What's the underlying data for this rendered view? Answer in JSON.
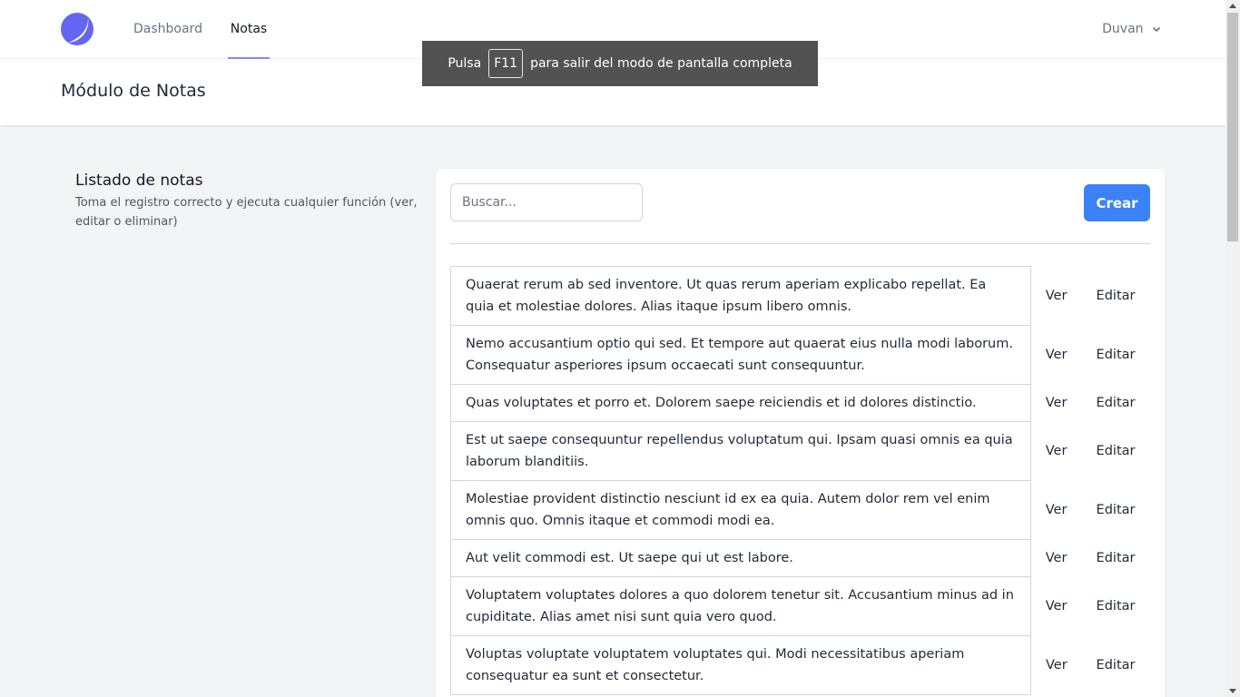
{
  "nav": {
    "logo_icon": "app-logo-icon",
    "links": [
      {
        "label": "Dashboard"
      },
      {
        "label": "Notas"
      }
    ],
    "user": "Duvan",
    "user_icon": "chevron-down-icon"
  },
  "header": {
    "title": "Módulo de Notas"
  },
  "toast": {
    "prefix": "Pulsa",
    "key": "F11",
    "suffix": "para salir del modo de pantalla completa"
  },
  "section": {
    "title": "Listado de notas",
    "description": "Toma el registro correcto y ejecuta cualquier función (ver, editar o eliminar)"
  },
  "toolbar": {
    "search_placeholder": "Buscar...",
    "create_label": "Crear"
  },
  "colors": {
    "primary": "#3b82f6",
    "active_tab_border": "#818cf8",
    "logo": "#6366f1"
  },
  "notes": [
    {
      "text": "Quaerat rerum ab sed inventore. Ut quas rerum aperiam explicabo repellat. Ea quia et molestiae dolores. Alias itaque ipsum libero omnis.",
      "view": "Ver",
      "edit": "Editar"
    },
    {
      "text": "Nemo accusantium optio qui sed. Et tempore aut quaerat eius nulla modi laborum. Consequatur asperiores ipsum occaecati sunt consequuntur.",
      "view": "Ver",
      "edit": "Editar"
    },
    {
      "text": "Quas voluptates et porro et. Dolorem saepe reiciendis et id dolores distinctio.",
      "view": "Ver",
      "edit": "Editar"
    },
    {
      "text": "Est ut saepe consequuntur repellendus voluptatum qui. Ipsam quasi omnis ea quia laborum blanditiis.",
      "view": "Ver",
      "edit": "Editar"
    },
    {
      "text": "Molestiae provident distinctio nesciunt id ex ea quia. Autem dolor rem vel enim omnis quo. Omnis itaque et commodi modi ea.",
      "view": "Ver",
      "edit": "Editar"
    },
    {
      "text": "Aut velit commodi est. Ut saepe qui ut est labore.",
      "view": "Ver",
      "edit": "Editar"
    },
    {
      "text": "Voluptatem voluptates dolores a quo dolorem tenetur sit. Accusantium minus ad in cupiditate. Alias amet nisi sunt quia vero quod.",
      "view": "Ver",
      "edit": "Editar"
    },
    {
      "text": "Voluptas voluptate voluptatem voluptates qui. Modi necessitatibus aperiam consequatur ea sunt et consectetur.",
      "view": "Ver",
      "edit": "Editar"
    }
  ]
}
